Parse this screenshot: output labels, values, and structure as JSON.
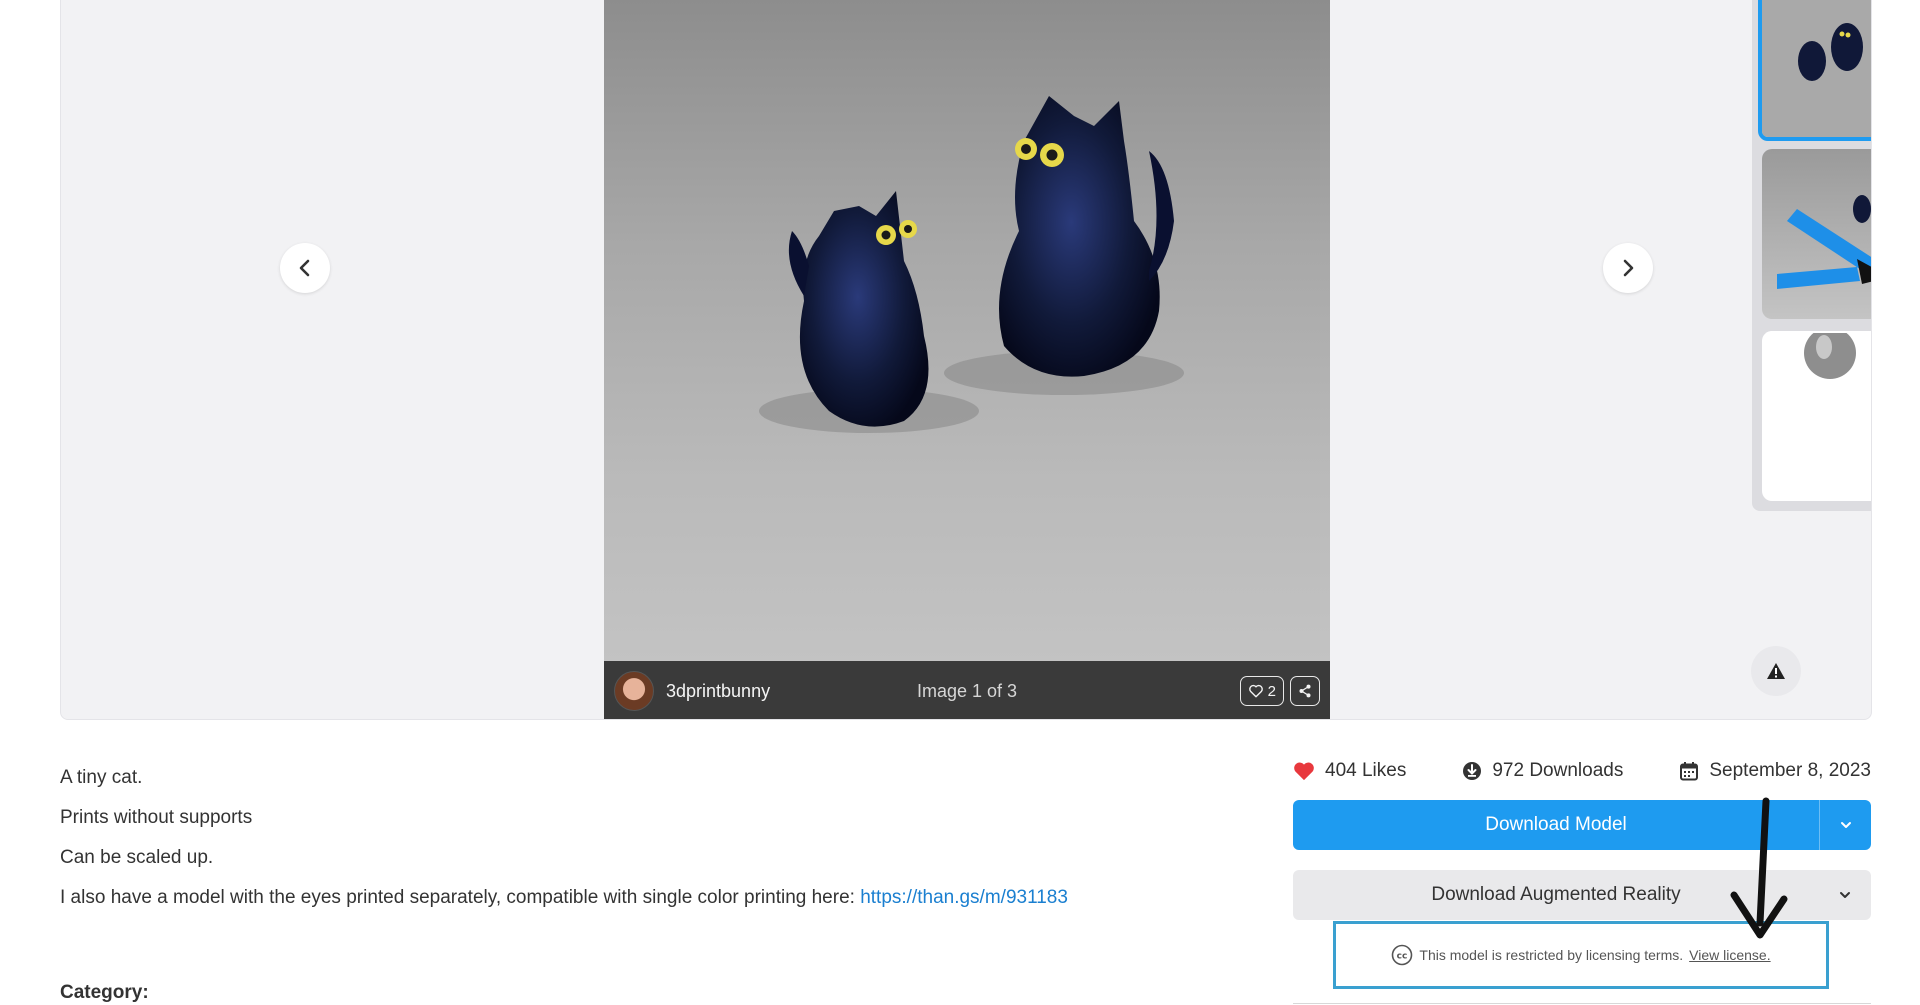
{
  "gallery": {
    "uploader_name": "3dprintbunny",
    "image_counter": "Image 1 of 3",
    "like_count": "2",
    "icons": {
      "prev": "chevron-left-icon",
      "next": "chevron-right-icon",
      "report": "warning-icon",
      "like": "heart-outline-icon",
      "share": "share-icon"
    },
    "thumbnails": [
      "thumbnail 1",
      "thumbnail 2",
      "thumbnail 3"
    ]
  },
  "description": {
    "lines": [
      "A tiny cat.",
      "Prints without supports",
      "Can be scaled up."
    ],
    "link_intro": "I also have a model with the eyes printed separately, compatible with single color printing here: ",
    "link_text": "https://than.gs/m/931183",
    "category_label": "Category:"
  },
  "stats": {
    "likes": "404 Likes",
    "downloads": "972 Downloads",
    "date": "September 8, 2023"
  },
  "actions": {
    "download_model": "Download Model",
    "download_ar": "Download Augmented Reality"
  },
  "license": {
    "text": "This model is restricted by licensing terms.",
    "link": "View license."
  },
  "colors": {
    "accent": "#1e9bf0",
    "heart": "#e8383d",
    "highlight_box": "#3aa0d0",
    "link": "#1a7fd0"
  }
}
